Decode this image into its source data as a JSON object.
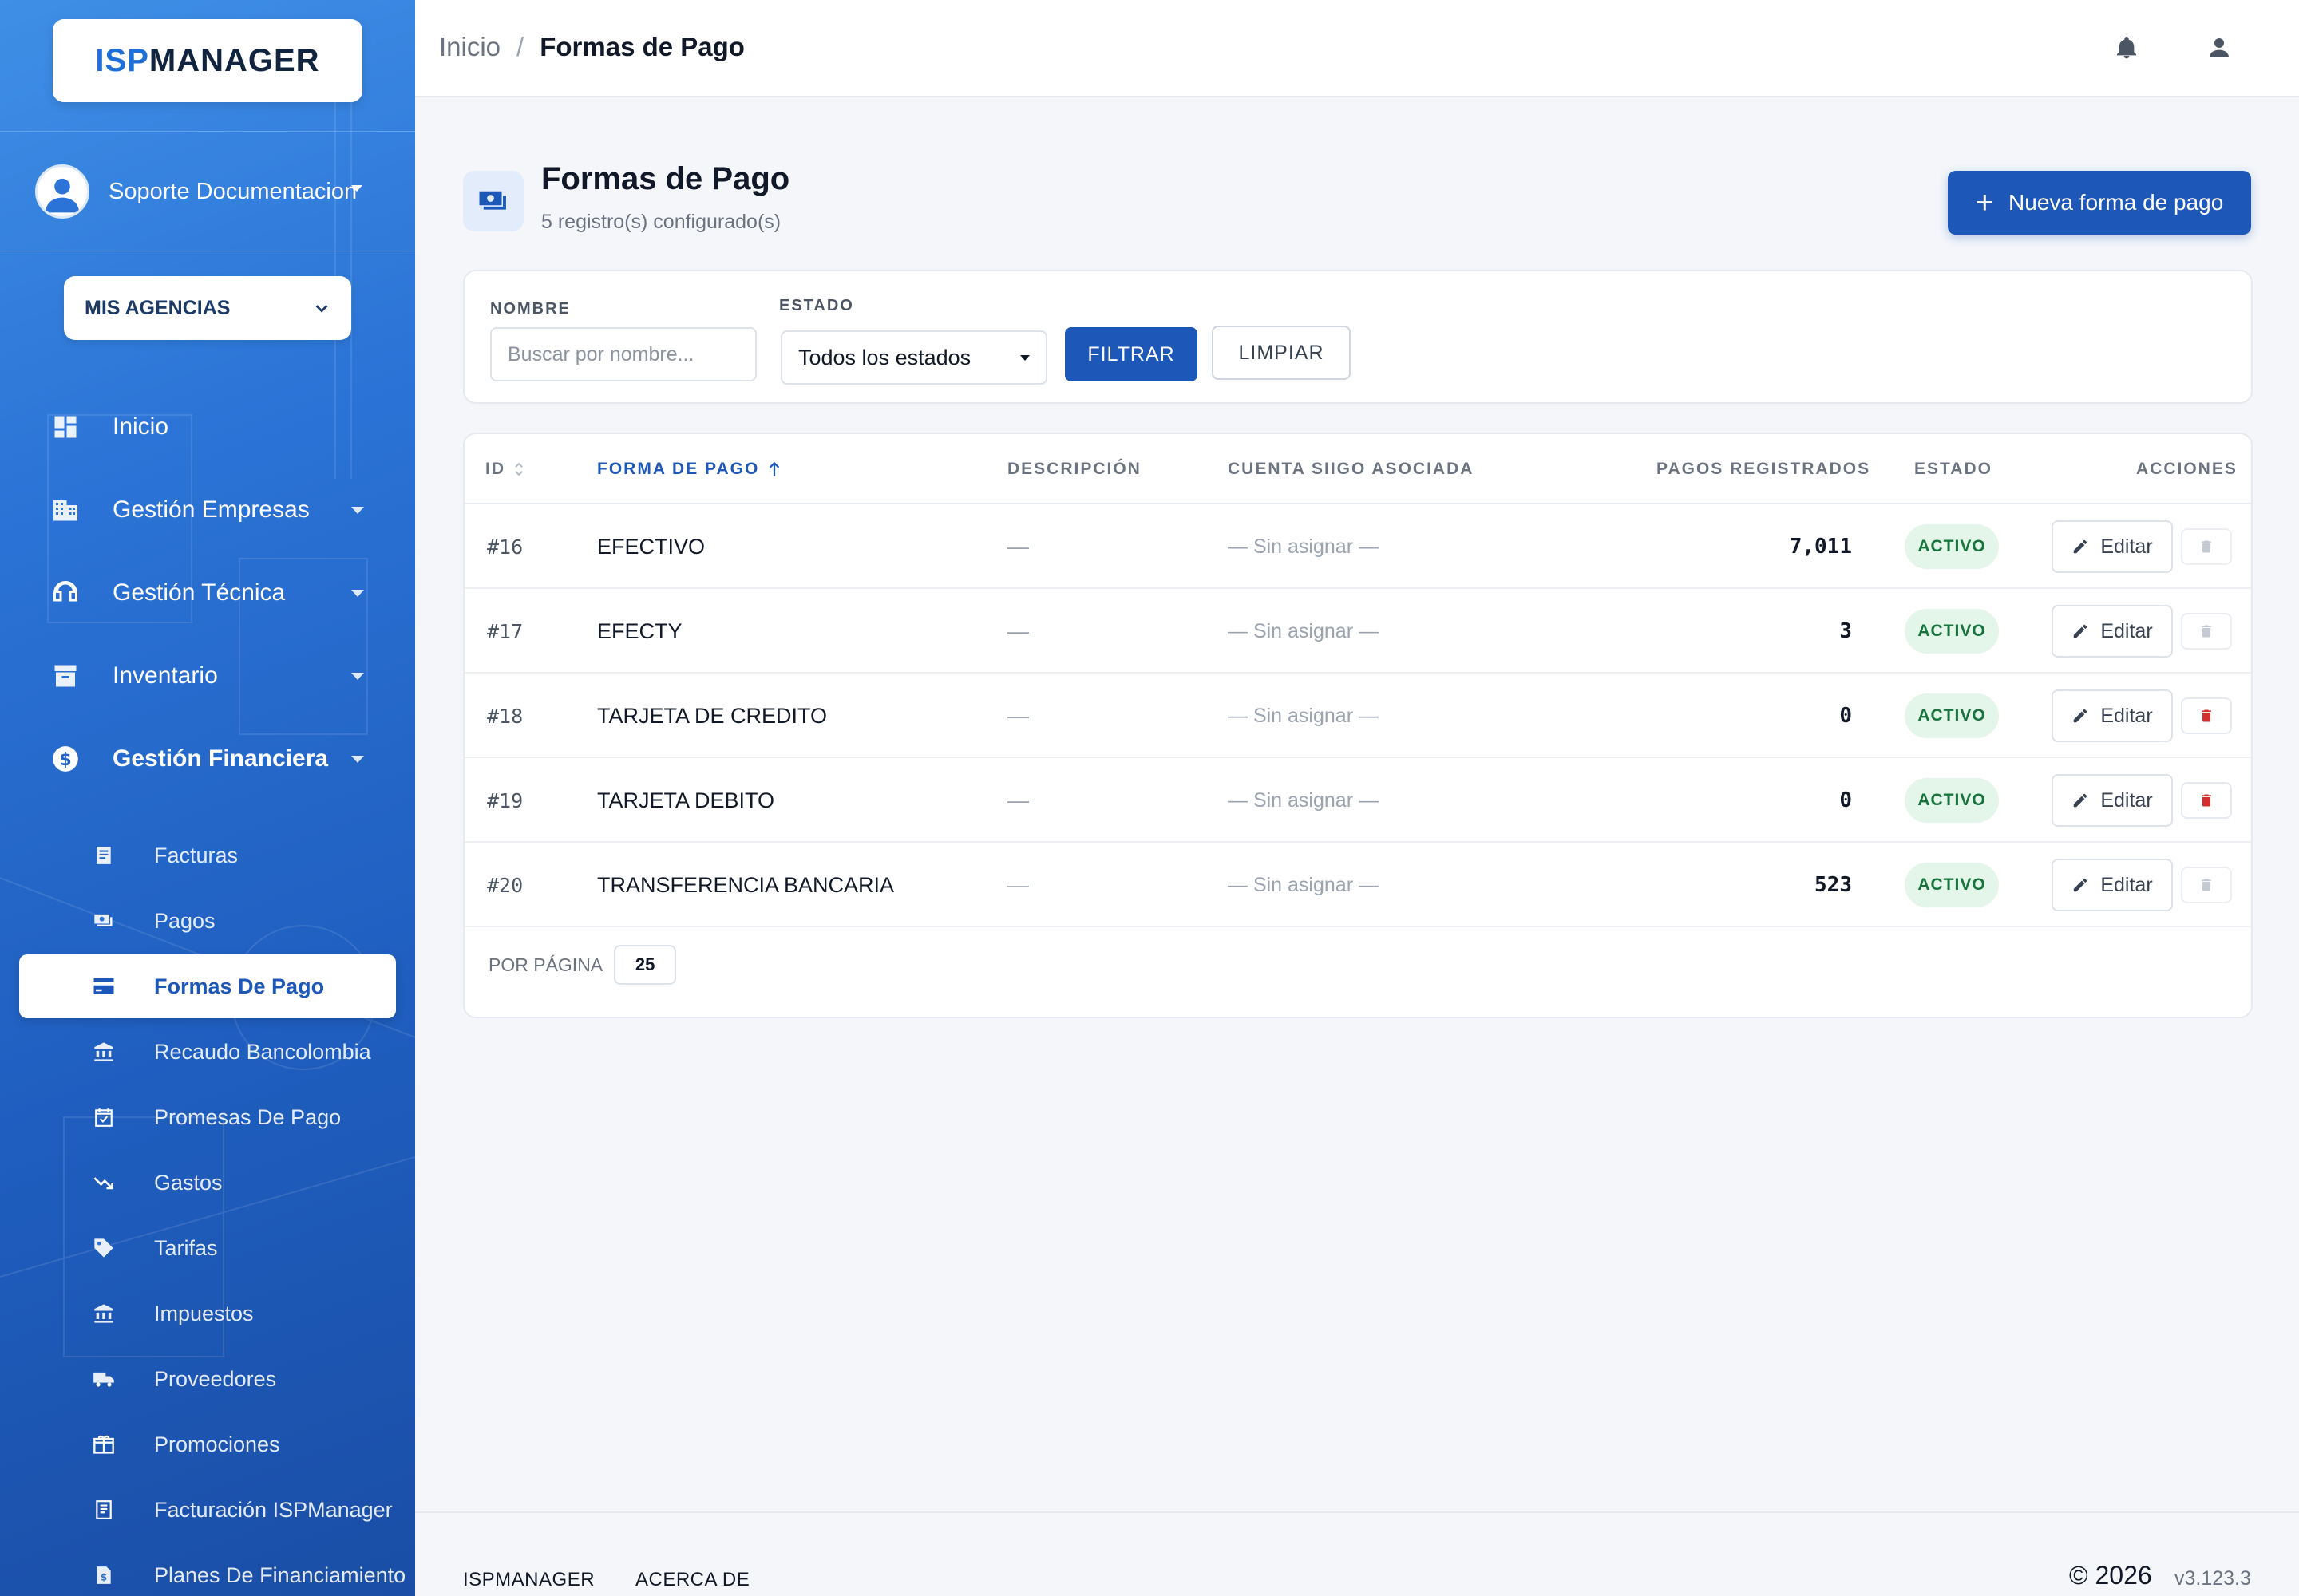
{
  "brand": {
    "prefix": "ISP",
    "suffix": "MANAGER"
  },
  "user": {
    "name": "Soporte Documentacion"
  },
  "agency_selector": {
    "label": "MIS AGENCIAS"
  },
  "nav": {
    "inicio": "Inicio",
    "empresas": "Gestión Empresas",
    "tecnica": "Gestión Técnica",
    "inventario": "Inventario",
    "financiera": "Gestión Financiera"
  },
  "financiera_items": [
    "Facturas",
    "Pagos",
    "Formas De Pago",
    "Recaudo Bancolombia",
    "Promesas De Pago",
    "Gastos",
    "Tarifas",
    "Impuestos",
    "Proveedores",
    "Promociones",
    "Facturación ISPManager",
    "Planes De Financiamiento"
  ],
  "breadcrumb": {
    "home": "Inicio",
    "separator": "/",
    "current": "Formas de Pago"
  },
  "page": {
    "title": "Formas de Pago",
    "subtitle": "5 registro(s) configurado(s)",
    "new_button": "Nueva forma de pago"
  },
  "filters": {
    "name_label": "NOMBRE",
    "name_placeholder": "Buscar por nombre...",
    "status_label": "ESTADO",
    "status_value": "Todos los estados",
    "filter_button": "FILTRAR",
    "clear_button": "LIMPIAR"
  },
  "table": {
    "headers": {
      "id": "ID",
      "name": "FORMA DE PAGO",
      "description": "DESCRIPCIÓN",
      "siigo": "CUENTA SIIGO ASOCIADA",
      "payments": "PAGOS REGISTRADOS",
      "status": "ESTADO",
      "actions": "ACCIONES"
    },
    "edit_label": "Editar",
    "rows": [
      {
        "id": "#16",
        "name": "EFECTIVO",
        "description": "—",
        "siigo": "— Sin asignar —",
        "payments": "7,011",
        "status": "ACTIVO",
        "delete_enabled": false
      },
      {
        "id": "#17",
        "name": "EFECTY",
        "description": "—",
        "siigo": "— Sin asignar —",
        "payments": "3",
        "status": "ACTIVO",
        "delete_enabled": false
      },
      {
        "id": "#18",
        "name": "TARJETA DE CREDITO",
        "description": "—",
        "siigo": "— Sin asignar —",
        "payments": "0",
        "status": "ACTIVO",
        "delete_enabled": true
      },
      {
        "id": "#19",
        "name": "TARJETA DEBITO",
        "description": "—",
        "siigo": "— Sin asignar —",
        "payments": "0",
        "status": "ACTIVO",
        "delete_enabled": true
      },
      {
        "id": "#20",
        "name": "TRANSFERENCIA BANCARIA",
        "description": "—",
        "siigo": "— Sin asignar —",
        "payments": "523",
        "status": "ACTIVO",
        "delete_enabled": false
      }
    ],
    "per_page_label": "POR PÁGINA",
    "per_page_value": "25"
  },
  "footer": {
    "link1": "ISPMANAGER",
    "link2": "ACERCA DE",
    "copyright": "© 2026",
    "version": "v3.123.3"
  },
  "colors": {
    "primary": "#1d57b8",
    "sidebar_top": "#3f8fe6",
    "sidebar_bottom": "#1a4ea6",
    "active_badge_bg": "#e4f5ea",
    "active_badge_text": "#17743d",
    "danger": "#d32f2f"
  }
}
